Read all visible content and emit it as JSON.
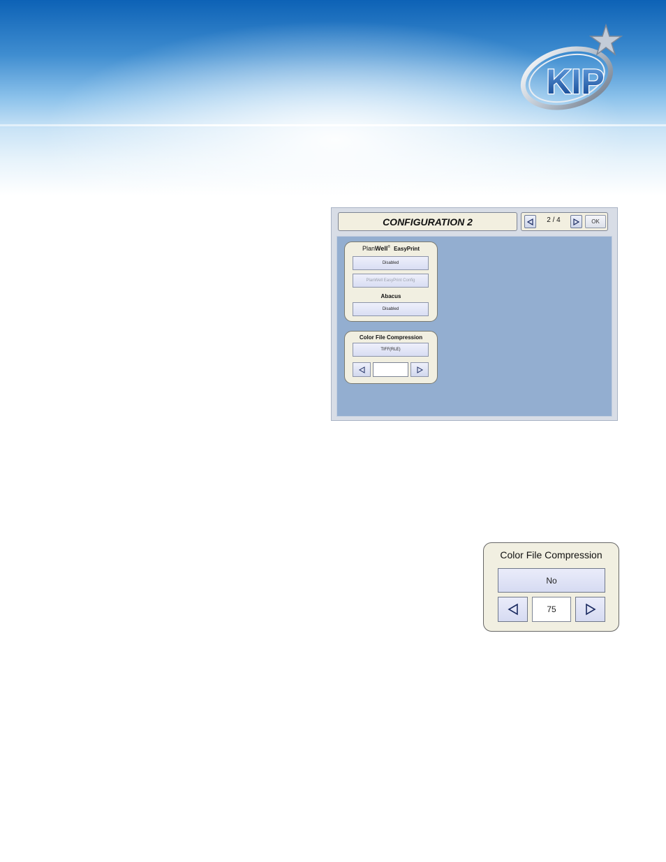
{
  "brand": {
    "logo_text": "KIP"
  },
  "config_screen": {
    "title": "CONFIGURATION 2",
    "page_indicator": "2 / 4",
    "ok_label": "OK",
    "planwell": {
      "title_plan": "Plan",
      "title_well": "Well",
      "title_easyprint": "EasyPrint",
      "status_button": "Disabled",
      "config_button": "PlanWell EasyPrint Config"
    },
    "abacus": {
      "title": "Abacus",
      "status_button": "Disabled"
    },
    "color_compression": {
      "title": "Color File Compression",
      "mode_button": "TIFF(RLE)",
      "value": ""
    }
  },
  "zoomed_widget": {
    "title": "Color File Compression",
    "mode_button": "No",
    "value": "75"
  },
  "icons": [
    "kip-logo-icon",
    "arrow-left-icon",
    "arrow-right-icon"
  ]
}
